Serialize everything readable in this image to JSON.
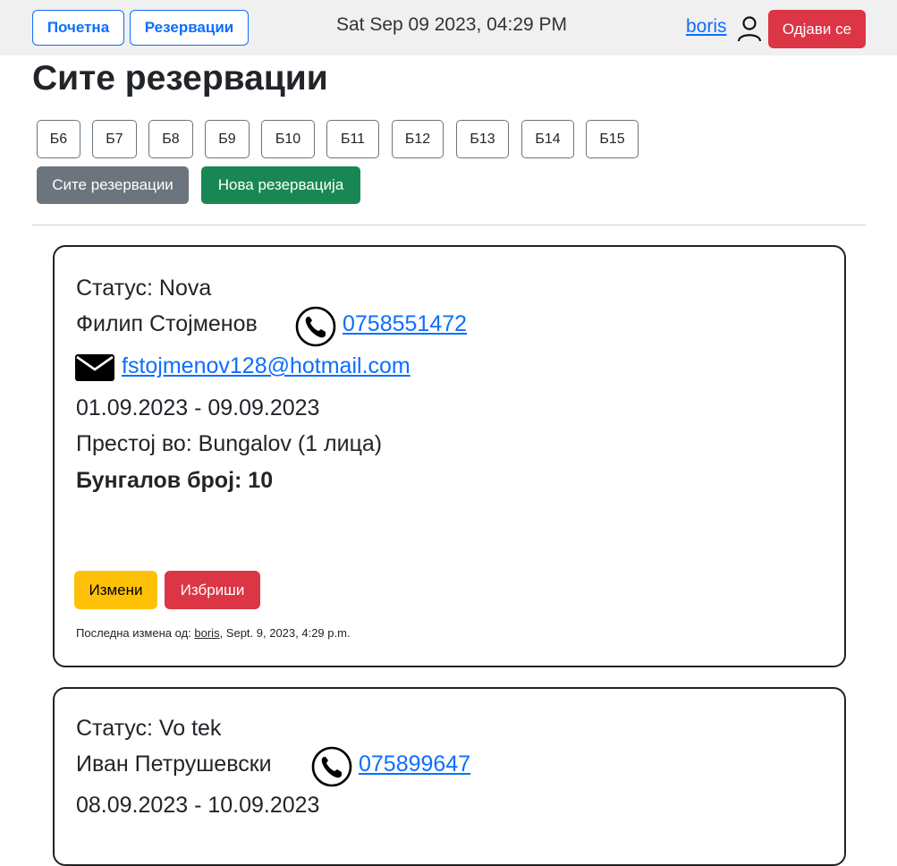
{
  "header": {
    "home_label": "Почетна",
    "reservations_label": "Резервации",
    "datetime": "Sat Sep 09 2023, 04:29 PM",
    "username": "boris",
    "logout_label": "Одјави се"
  },
  "page_title": "Сите резервации",
  "bungalow_filters": [
    "Б6",
    "Б7",
    "Б8",
    "Б9",
    "Б10",
    "Б11",
    "Б12",
    "Б13",
    "Б14",
    "Б15"
  ],
  "actions": {
    "all_label": "Сите резервации",
    "new_label": "Нова резервација"
  },
  "colors": {
    "primary": "#0d6efd",
    "danger": "#dc3545",
    "warning": "#ffc107",
    "success": "#198754",
    "secondary": "#6c757d"
  },
  "reservations": [
    {
      "status": "Статус: Nova",
      "name": "Филип Стојменов",
      "phone": "0758551472",
      "email": "fstojmenov128@hotmail.com",
      "dates": "01.09.2023 - 09.09.2023",
      "stay": "Престој во: Bungalov (1 лица)",
      "bungalow": "Бунгалов број: 10",
      "edit_label": "Измени",
      "delete_label": "Избриши",
      "modified_prefix": "Последна измена од:",
      "modified_user": "boris",
      "modified_time": ", Sept. 9, 2023, 4:29 p.m."
    },
    {
      "status": "Статус: Vo tek",
      "name": "Иван Петрушевски",
      "phone": "075899647",
      "dates": "08.09.2023 - 10.09.2023"
    }
  ]
}
